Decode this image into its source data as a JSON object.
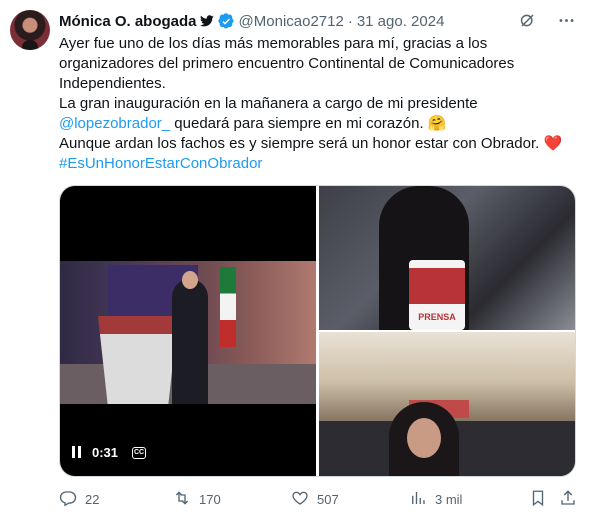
{
  "tweet": {
    "author_name": "Mónica O. abogada",
    "handle": "@Monicao2712",
    "separator": "·",
    "date": "31 ago. 2024",
    "text_lines": [
      "Ayer fue uno de los días más memorables para mí, gracias a los",
      "organizadores del primero encuentro Continental de Comunicadores",
      "Independientes.",
      "La gran inauguración en la mañanera a cargo de mi presidente"
    ],
    "mention": "@lopezobrador_",
    "after_mention": " quedará para siempre en mi corazón. 🤗",
    "line_six": "Aunque ardan los fachos es y siempre será un honor estar con Obrador. ❤️",
    "hashtag": "#EsUnHonorEstarConObrador"
  },
  "media": {
    "video_time": "0:31",
    "cc_label": "CC",
    "badge_text": "PRENSA"
  },
  "actions": {
    "replies": "22",
    "retweets": "170",
    "likes": "507",
    "views": "3 mil"
  },
  "icons": {
    "header": [
      "twitter-bird-icon",
      "verified-badge-icon",
      "grok-icon",
      "more-icon"
    ],
    "actions": [
      "reply-icon",
      "retweet-icon",
      "like-icon",
      "views-icon",
      "bookmark-icon",
      "share-icon"
    ]
  },
  "colors": {
    "link": "#1d9bf0",
    "secondary_text": "#536471",
    "verified": "#1d9bf0",
    "heart": "#e0245e"
  }
}
